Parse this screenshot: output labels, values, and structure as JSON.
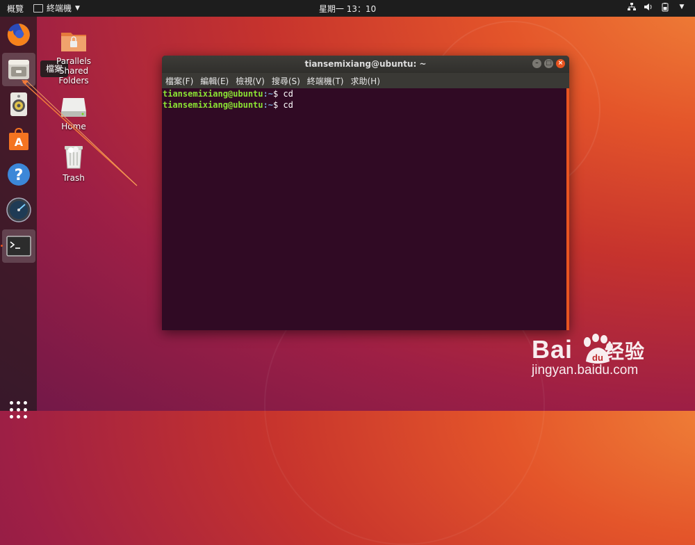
{
  "topbar": {
    "activities": "概覽",
    "app_menu": "終端機",
    "clock": "星期一 13：10",
    "tray_icons": [
      "network-icon",
      "volume-icon",
      "battery-icon",
      "menu-arrow-icon"
    ]
  },
  "dock": {
    "items": [
      {
        "name": "firefox",
        "icon": "firefox-icon"
      },
      {
        "name": "files",
        "icon": "file-cabinet-icon",
        "active": true
      },
      {
        "name": "rhythmbox",
        "icon": "speaker-icon"
      },
      {
        "name": "software",
        "icon": "shopping-bag-icon"
      },
      {
        "name": "help",
        "icon": "question-icon"
      },
      {
        "name": "disk-usage",
        "icon": "gauge-icon"
      },
      {
        "name": "terminal",
        "icon": "terminal-icon",
        "running": true
      }
    ],
    "tooltip": "檔案"
  },
  "desktop": {
    "icons": [
      {
        "label": "Parallels Shared Folders",
        "icon": "shared-folder-icon"
      },
      {
        "label": "Home",
        "icon": "home-drive-icon"
      },
      {
        "label": "Trash",
        "icon": "trash-icon"
      }
    ]
  },
  "terminal": {
    "title": "tiansemixiang@ubuntu: ~",
    "menu": [
      "檔案(F)",
      "編輯(E)",
      "檢視(V)",
      "搜尋(S)",
      "終端機(T)",
      "求助(H)"
    ],
    "lines": [
      {
        "user": "tiansemixiang@ubuntu",
        "path": ":~",
        "cmd": "$ cd"
      },
      {
        "user": "tiansemixiang@ubuntu",
        "path": ":~",
        "cmd": "$ cd"
      }
    ]
  },
  "watermark": {
    "main": "Bai",
    "main_cn": "经验",
    "du": "du",
    "sub": "jingyan.baidu.com"
  },
  "colors": {
    "accent": "#e95420",
    "terminal_bg": "#300a24",
    "prompt_user": "#8ae234",
    "prompt_path": "#729fcf"
  }
}
